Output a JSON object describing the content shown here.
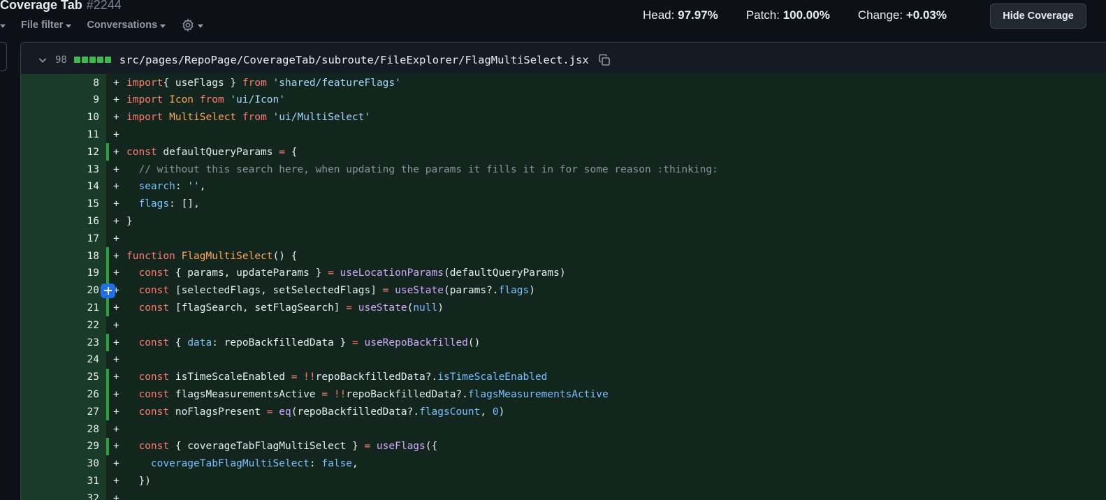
{
  "header": {
    "title": "Coverage Tab",
    "pr_number": "#2244",
    "filters": {
      "file_filter": "File filter",
      "conversations": "Conversations"
    },
    "stats": {
      "head_label": "Head:",
      "head_value": "97.97%",
      "patch_label": "Patch:",
      "patch_value": "100.00%",
      "change_label": "Change:",
      "change_value": "+0.03%"
    },
    "hide_coverage_label": "Hide Coverage"
  },
  "file": {
    "changed_lines": "98",
    "path": "src/pages/RepoPage/CoverageTab/subroute/FileExplorer/FlagMultiSelect.jsx"
  },
  "colors": {
    "added_line_bg": "#12261e",
    "gutter_bg": "#1a3b27",
    "covered_bar": "#2ea043",
    "add_comment_button": "#1f6feb"
  },
  "lines": [
    {
      "n": "8",
      "segs": [
        [
          "k",
          "import"
        ],
        [
          "",
          "{ useFlags } "
        ],
        [
          "k",
          "from"
        ],
        [
          "s",
          " 'shared/featureFlags'"
        ]
      ]
    },
    {
      "n": "9",
      "segs": [
        [
          "k",
          "import"
        ],
        [
          "t",
          " Icon "
        ],
        [
          "k",
          "from"
        ],
        [
          "s",
          " 'ui/Icon'"
        ]
      ]
    },
    {
      "n": "10",
      "segs": [
        [
          "k",
          "import"
        ],
        [
          "t",
          " MultiSelect "
        ],
        [
          "k",
          "from"
        ],
        [
          "s",
          " 'ui/MultiSelect'"
        ]
      ]
    },
    {
      "n": "11",
      "segs": []
    },
    {
      "n": "12",
      "covered": true,
      "segs": [
        [
          "k",
          "const"
        ],
        [
          "",
          " defaultQueryParams "
        ],
        [
          "k",
          "="
        ],
        [
          "",
          " {"
        ]
      ]
    },
    {
      "n": "13",
      "segs": [
        [
          "c",
          "  // without this search here, when updating the params it fills it in for some reason :thinking:"
        ]
      ]
    },
    {
      "n": "14",
      "segs": [
        [
          "p",
          "  search"
        ],
        [
          "",
          ": "
        ],
        [
          "s",
          "''"
        ],
        [
          "",
          ","
        ]
      ]
    },
    {
      "n": "15",
      "segs": [
        [
          "p",
          "  flags"
        ],
        [
          "",
          ": [],"
        ]
      ]
    },
    {
      "n": "16",
      "segs": [
        [
          "",
          "}"
        ]
      ]
    },
    {
      "n": "17",
      "segs": []
    },
    {
      "n": "18",
      "covered": true,
      "segs": [
        [
          "k",
          "function"
        ],
        [
          "t",
          " FlagMultiSelect"
        ],
        [
          "",
          "() {"
        ]
      ]
    },
    {
      "n": "19",
      "covered": true,
      "segs": [
        [
          "k",
          "  const"
        ],
        [
          "",
          " { params, updateParams } "
        ],
        [
          "k",
          "="
        ],
        [
          "f",
          " useLocationParams"
        ],
        [
          "",
          "(defaultQueryParams)"
        ]
      ]
    },
    {
      "n": "20",
      "covered": true,
      "add_button": true,
      "segs": [
        [
          "k",
          "  const"
        ],
        [
          "",
          " [selectedFlags, setSelectedFlags] "
        ],
        [
          "k",
          "="
        ],
        [
          "f",
          " useState"
        ],
        [
          "",
          "(params?."
        ],
        [
          "p",
          "flags"
        ],
        [
          "",
          ")"
        ]
      ]
    },
    {
      "n": "21",
      "covered": true,
      "segs": [
        [
          "k",
          "  const"
        ],
        [
          "",
          " [flagSearch, setFlagSearch] "
        ],
        [
          "k",
          "="
        ],
        [
          "f",
          " useState"
        ],
        [
          "",
          "("
        ],
        [
          "p",
          "null"
        ],
        [
          "",
          ")"
        ]
      ]
    },
    {
      "n": "22",
      "segs": []
    },
    {
      "n": "23",
      "covered": true,
      "segs": [
        [
          "k",
          "  const"
        ],
        [
          "",
          " { "
        ],
        [
          "p",
          "data"
        ],
        [
          "",
          ": repoBackfilledData } "
        ],
        [
          "k",
          "="
        ],
        [
          "f",
          " useRepoBackfilled"
        ],
        [
          "",
          "()"
        ]
      ]
    },
    {
      "n": "24",
      "segs": []
    },
    {
      "n": "25",
      "covered": true,
      "segs": [
        [
          "k",
          "  const"
        ],
        [
          "",
          " isTimeScaleEnabled "
        ],
        [
          "k",
          "="
        ],
        [
          "k",
          " !!"
        ],
        [
          "",
          "repoBackfilledData?."
        ],
        [
          "p",
          "isTimeScaleEnabled"
        ]
      ]
    },
    {
      "n": "26",
      "covered": true,
      "segs": [
        [
          "k",
          "  const"
        ],
        [
          "",
          " flagsMeasurementsActive "
        ],
        [
          "k",
          "="
        ],
        [
          "k",
          " !!"
        ],
        [
          "",
          "repoBackfilledData?."
        ],
        [
          "p",
          "flagsMeasurementsActive"
        ]
      ]
    },
    {
      "n": "27",
      "covered": true,
      "segs": [
        [
          "k",
          "  const"
        ],
        [
          "",
          " noFlagsPresent "
        ],
        [
          "k",
          "="
        ],
        [
          "f",
          " eq"
        ],
        [
          "",
          "(repoBackfilledData?."
        ],
        [
          "p",
          "flagsCount"
        ],
        [
          "",
          ", "
        ],
        [
          "p",
          "0"
        ],
        [
          "",
          ")"
        ]
      ]
    },
    {
      "n": "28",
      "segs": []
    },
    {
      "n": "29",
      "covered": true,
      "segs": [
        [
          "k",
          "  const"
        ],
        [
          "",
          " { coverageTabFlagMultiSelect } "
        ],
        [
          "k",
          "="
        ],
        [
          "f",
          " useFlags"
        ],
        [
          "",
          "({"
        ]
      ]
    },
    {
      "n": "30",
      "segs": [
        [
          "p",
          "    coverageTabFlagMultiSelect"
        ],
        [
          "",
          ": "
        ],
        [
          "p",
          "false"
        ],
        [
          "",
          ","
        ]
      ]
    },
    {
      "n": "31",
      "segs": [
        [
          "",
          "  })"
        ]
      ]
    },
    {
      "n": "32",
      "segs": []
    }
  ]
}
